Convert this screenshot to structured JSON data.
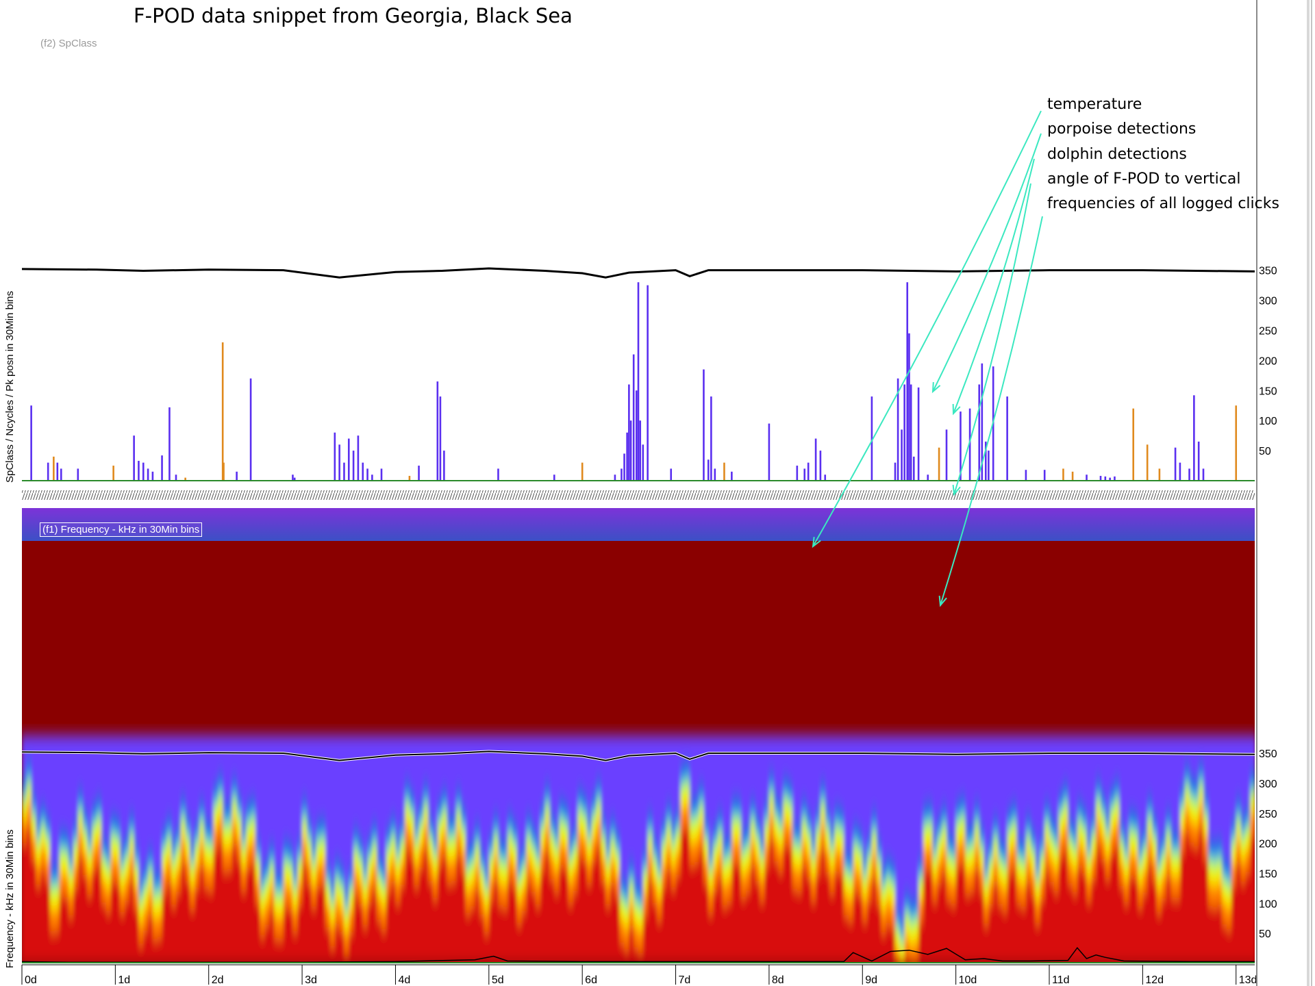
{
  "title": "F-POD data snippet from Georgia, Black Sea",
  "colors": {
    "porpoise": "#5a2ff0",
    "dolphin": "#e08a1e",
    "temperature": "#000000",
    "baseline": "#2a8a2a",
    "arrow": "#3be8c0"
  },
  "legend": [
    "temperature",
    "porpoise detections",
    "dolphin detections",
    "angle of F-POD to vertical",
    "frequencies of all logged clicks"
  ],
  "chart_data": [
    {
      "type": "bar",
      "panel_label": "(f2) SpClass",
      "ylabel": "SpClass / Ncycles / Pk posn  in 30Min bins",
      "ylim": [
        0,
        370
      ],
      "y_ticks": [
        "350",
        "300",
        "250",
        "200",
        "150",
        "100",
        "50"
      ],
      "x_ticks": [
        "0d",
        "1d",
        "2d",
        "3d",
        "4d",
        "5d",
        "6d",
        "7d",
        "8d",
        "9d",
        "10d",
        "11d",
        "12d",
        "13d"
      ],
      "xlim": [
        0,
        13.2
      ],
      "series": [
        {
          "name": "porpoise detections",
          "x": [
            0.1,
            0.28,
            0.38,
            0.42,
            0.6,
            1.2,
            1.25,
            1.3,
            1.35,
            1.4,
            1.5,
            1.58,
            1.65,
            2.3,
            2.45,
            2.9,
            2.92,
            3.35,
            3.4,
            3.45,
            3.5,
            3.55,
            3.6,
            3.65,
            3.7,
            3.75,
            3.85,
            4.25,
            4.45,
            4.48,
            4.52,
            5.1,
            5.7,
            6.35,
            6.42,
            6.45,
            6.48,
            6.5,
            6.52,
            6.55,
            6.58,
            6.6,
            6.62,
            6.65,
            6.7,
            6.95,
            7.3,
            7.35,
            7.38,
            7.42,
            7.6,
            8.0,
            8.3,
            8.38,
            8.42,
            8.5,
            8.55,
            8.6,
            9.1,
            9.35,
            9.38,
            9.42,
            9.45,
            9.48,
            9.5,
            9.52,
            9.55,
            9.6,
            9.7,
            9.9,
            10.05,
            10.15,
            10.25,
            10.28,
            10.32,
            10.35,
            10.4,
            10.55,
            10.75,
            10.95,
            11.4,
            11.55,
            11.6,
            11.65,
            11.7,
            12.35,
            12.4,
            12.5,
            12.55,
            12.6,
            12.65
          ],
          "values": [
            125,
            30,
            30,
            20,
            20,
            75,
            33,
            30,
            20,
            15,
            42,
            122,
            10,
            15,
            170,
            10,
            5,
            80,
            60,
            30,
            70,
            50,
            75,
            30,
            20,
            10,
            20,
            25,
            165,
            140,
            50,
            20,
            10,
            10,
            20,
            45,
            80,
            160,
            100,
            210,
            150,
            330,
            100,
            60,
            325,
            20,
            185,
            35,
            140,
            20,
            15,
            95,
            25,
            20,
            30,
            70,
            50,
            10,
            140,
            30,
            170,
            85,
            160,
            330,
            245,
            160,
            40,
            155,
            10,
            85,
            115,
            120,
            160,
            195,
            65,
            50,
            190,
            140,
            18,
            18,
            10,
            8,
            7,
            5,
            7,
            55,
            30,
            20,
            142,
            65,
            20
          ]
        },
        {
          "name": "dolphin detections",
          "x": [
            0.34,
            0.98,
            1.75,
            2.15,
            2.16,
            4.15,
            6.0,
            7.52,
            9.82,
            11.15,
            11.25,
            11.9,
            12.05,
            12.18,
            13.0
          ],
          "values": [
            40,
            25,
            5,
            230,
            30,
            8,
            30,
            30,
            55,
            20,
            15,
            120,
            60,
            20,
            125
          ]
        }
      ],
      "temperature_line": {
        "name": "temperature",
        "x": [
          0,
          0.8,
          1.3,
          2,
          2.8,
          3.4,
          4,
          4.5,
          5,
          5.6,
          6,
          6.25,
          6.5,
          7,
          7.15,
          7.35,
          8,
          9,
          10,
          11,
          12,
          13.2
        ],
        "y": [
          352,
          351,
          349,
          351,
          350,
          338,
          347,
          349,
          353,
          349,
          345,
          338,
          346,
          350,
          340,
          350,
          350,
          350,
          348,
          350,
          350,
          348
        ]
      }
    },
    {
      "type": "heatmap",
      "panel_label": "(f1) Frequency - kHz  in 30Min bins",
      "ylabel": "Frequency - kHz  in 30Min bins",
      "ylim": [
        0,
        380
      ],
      "y_ticks": [
        "350",
        "300",
        "250",
        "200",
        "150",
        "100",
        "50"
      ],
      "x_ticks": [
        "0d",
        "1d",
        "2d",
        "3d",
        "4d",
        "5d",
        "6d",
        "7d",
        "8d",
        "9d",
        "10d",
        "11d",
        "12d",
        "13d"
      ],
      "xlim": [
        0,
        13.2
      ],
      "colorscale": [
        "#8a0000",
        "#d81010",
        "#ff7a00",
        "#ffe800",
        "#c8ff20",
        "#30c0e0",
        "#2e5ee8",
        "#6a40ff"
      ],
      "intensity_edge_khz": {
        "x": [
          0,
          0.3,
          0.8,
          1.3,
          1.8,
          2.4,
          2.6,
          3,
          3.4,
          3.8,
          4.3,
          4.6,
          5,
          5.5,
          6,
          6.3,
          6.55,
          6.7,
          7.1,
          7.5,
          8,
          8.6,
          9.2,
          9.5,
          9.7,
          10.2,
          10.7,
          11.2,
          11.7,
          12.2,
          12.5,
          12.8,
          13.2
        ],
        "y": [
          260,
          150,
          210,
          120,
          200,
          240,
          90,
          190,
          110,
          160,
          230,
          200,
          150,
          190,
          220,
          190,
          60,
          160,
          250,
          170,
          230,
          200,
          140,
          30,
          210,
          180,
          170,
          210,
          220,
          160,
          280,
          140,
          240
        ]
      },
      "temperature_line": {
        "name": "temperature",
        "x": [
          0,
          0.8,
          1.3,
          2,
          2.8,
          3.4,
          4,
          4.5,
          5,
          5.6,
          6,
          6.25,
          6.5,
          7,
          7.15,
          7.35,
          8,
          9,
          10,
          11,
          12,
          13.2
        ],
        "y": [
          352,
          351,
          349,
          351,
          350,
          338,
          347,
          349,
          353,
          349,
          345,
          338,
          346,
          350,
          340,
          350,
          350,
          350,
          348,
          350,
          350,
          348
        ]
      },
      "angle_line": {
        "name": "angle of F-POD to vertical",
        "x": [
          0,
          0.5,
          1,
          2,
          3,
          4,
          4.85,
          5.05,
          5.2,
          6,
          7,
          8,
          8.8,
          8.9,
          9.1,
          9.3,
          9.5,
          9.7,
          9.9,
          10.1,
          10.3,
          10.5,
          10.8,
          11.2,
          11.3,
          11.4,
          11.5,
          11.6,
          11.8,
          12.5,
          13.2
        ],
        "y": [
          3,
          2,
          2,
          2,
          2,
          3,
          6,
          12,
          4,
          3,
          3,
          3,
          3,
          18,
          4,
          20,
          22,
          15,
          25,
          6,
          8,
          4,
          4,
          5,
          26,
          8,
          14,
          10,
          4,
          3,
          3
        ]
      }
    }
  ]
}
